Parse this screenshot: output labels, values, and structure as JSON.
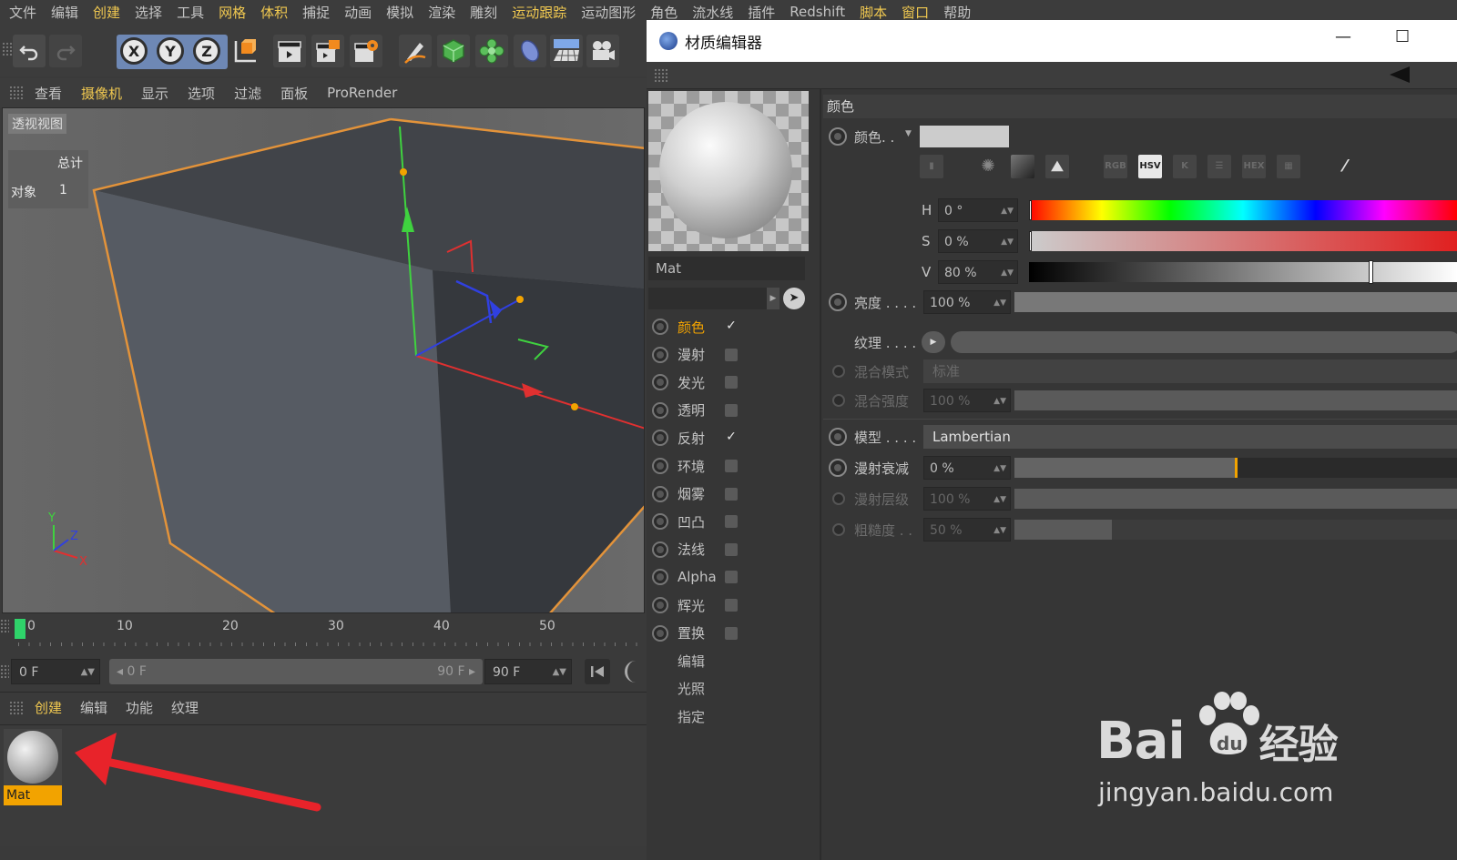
{
  "menubar": {
    "items": [
      "文件",
      "编辑",
      "创建",
      "选择",
      "工具",
      "网格",
      "体积",
      "捕捉",
      "动画",
      "模拟",
      "渲染",
      "雕刻",
      "运动跟踪",
      "运动图形",
      "角色",
      "流水线",
      "插件",
      "Redshift",
      "脚本",
      "窗口",
      "帮助"
    ],
    "highlighted": [
      "创建",
      "网格",
      "体积",
      "运动跟踪",
      "脚本",
      "窗口"
    ]
  },
  "toolbar": {
    "axes": [
      "X",
      "Y",
      "Z"
    ]
  },
  "viewport_menu": {
    "items": [
      "查看",
      "摄像机",
      "显示",
      "选项",
      "过滤",
      "面板",
      "ProRender"
    ],
    "highlighted": [
      "摄像机"
    ]
  },
  "viewport": {
    "title": "透视视图",
    "stats": {
      "total_label": "总计",
      "objects_label": "对象",
      "objects_count": "1"
    },
    "axis_labels": {
      "x": "X",
      "y": "Y",
      "z": "Z"
    }
  },
  "timeline": {
    "ticks": [
      "0",
      "10",
      "20",
      "30",
      "40",
      "50"
    ],
    "current_frame": "0 F",
    "range_start": "0 F",
    "range_end": "90 F",
    "end_frame": "90 F"
  },
  "material_manager": {
    "menu": [
      "创建",
      "编辑",
      "功能",
      "纹理"
    ],
    "highlighted": [
      "创建"
    ],
    "materials": [
      {
        "name": "Mat"
      }
    ]
  },
  "editor": {
    "title": "材质编辑器",
    "material_name": "Mat",
    "channels": [
      {
        "name": "颜色",
        "checked": true,
        "active": true
      },
      {
        "name": "漫射",
        "checked": false
      },
      {
        "name": "发光",
        "checked": false
      },
      {
        "name": "透明",
        "checked": false
      },
      {
        "name": "反射",
        "checked": true
      },
      {
        "name": "环境",
        "checked": false
      },
      {
        "name": "烟雾",
        "checked": false
      },
      {
        "name": "凹凸",
        "checked": false
      },
      {
        "name": "法线",
        "checked": false
      },
      {
        "name": "Alpha",
        "checked": false
      },
      {
        "name": "辉光",
        "checked": false
      },
      {
        "name": "置换",
        "checked": false
      }
    ],
    "extra_tabs": [
      "编辑",
      "光照",
      "指定"
    ],
    "section_title": "颜色",
    "color_label": "颜色. .",
    "color_swatch": "#cccccc",
    "color_modes": [
      "RGB",
      "HSV",
      "K",
      "HEX"
    ],
    "active_mode": "HSV",
    "hsv": {
      "h_label": "H",
      "h": "0 °",
      "s_label": "S",
      "s": "0 %",
      "v_label": "V",
      "v": "80 %",
      "v_level": 0.8
    },
    "brightness": {
      "label": "亮度 . . . .",
      "value": "100 %",
      "level": 1.0
    },
    "texture_label": "纹理 . . . .",
    "blend_mode": {
      "label": "混合模式",
      "value": "标准"
    },
    "blend_strength": {
      "label": "混合强度",
      "value": "100 %",
      "level": 1.0
    },
    "model": {
      "label": "模型 . . . .",
      "value": "Lambertian"
    },
    "diffuse_falloff": {
      "label": "漫射衰减",
      "value": "0 %",
      "level": 0.5
    },
    "diffuse_level": {
      "label": "漫射层级",
      "value": "100 %",
      "level": 1.0
    },
    "roughness": {
      "label": "粗糙度 . .",
      "value": "50 %",
      "level": 0.22
    }
  },
  "watermark": {
    "brand": "Bai",
    "brand_tail": "经验",
    "url": "jingyan.baidu.com"
  }
}
